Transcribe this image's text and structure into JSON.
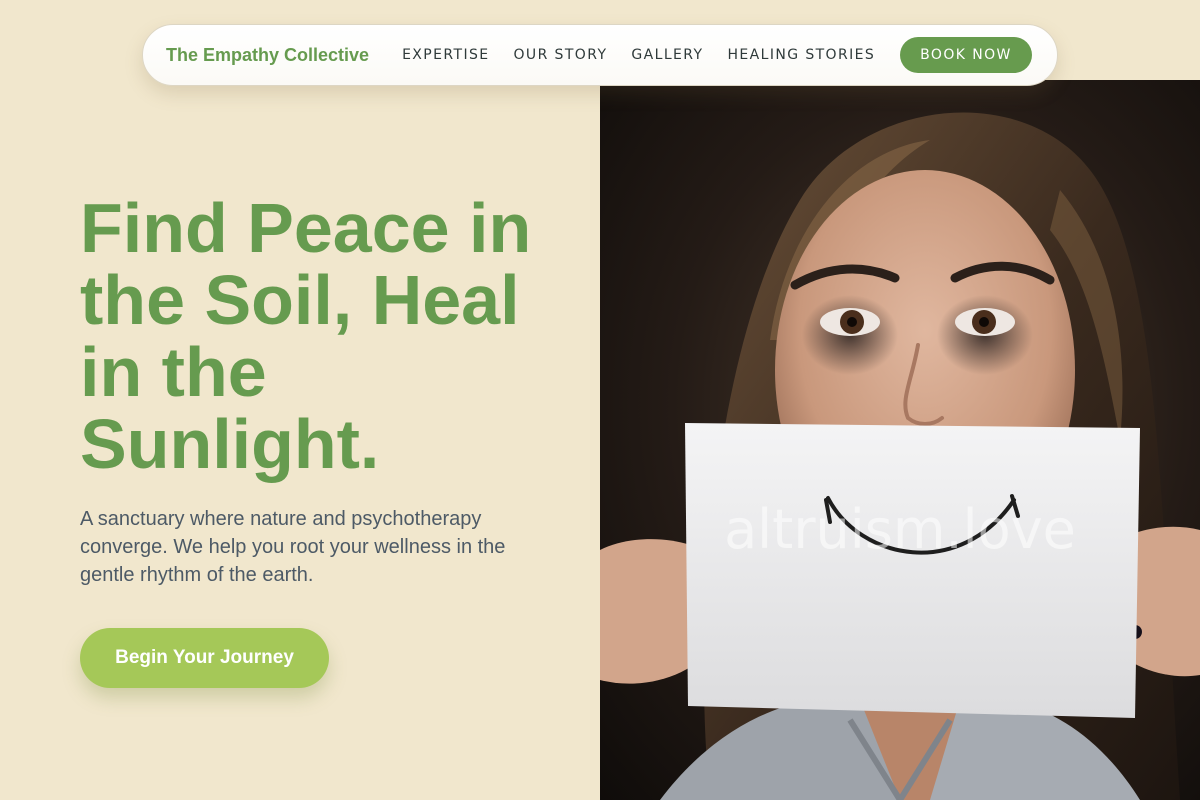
{
  "nav": {
    "brand": "The Empathy Collective",
    "links": [
      {
        "label": "EXPERTISE"
      },
      {
        "label": "OUR STORY"
      },
      {
        "label": "GALLERY"
      },
      {
        "label": "HEALING STORIES"
      }
    ],
    "cta_label": "BOOK NOW"
  },
  "hero": {
    "headline": "Find Peace in the Soil, Heal in the Sunlight.",
    "subcopy": "A sanctuary where nature and psychotherapy converge. We help you root your wellness in the gentle rhythm of the earth.",
    "cta_label": "Begin Your Journey",
    "image_watermark": "altruism.love"
  },
  "colors": {
    "page_background": "#f1e7cd",
    "brand_green": "#669b4f",
    "cta_lime": "#a5c858",
    "body_text": "#4d5a66"
  },
  "icons": [
    "smiley-drawing"
  ]
}
